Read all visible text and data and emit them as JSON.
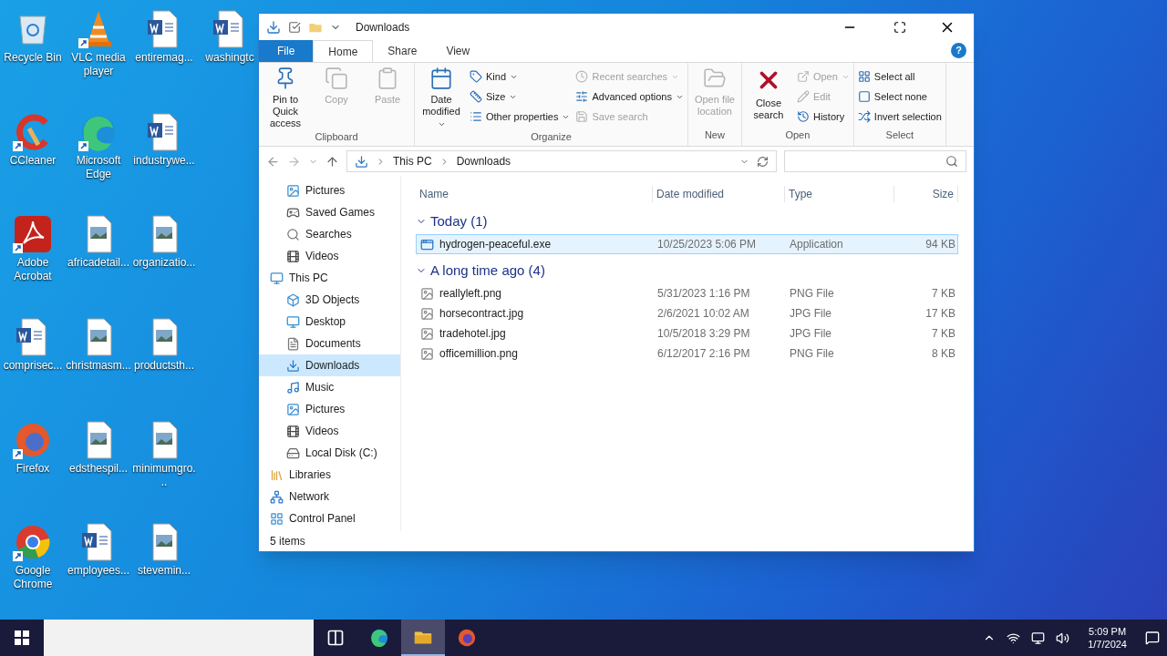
{
  "desktop_icons": [
    {
      "label": "Recycle Bin",
      "kind": "recycle",
      "shortcut": false
    },
    {
      "label": "CCleaner",
      "kind": "ccleaner",
      "shortcut": true
    },
    {
      "label": "Adobe Acrobat",
      "kind": "acrobat",
      "shortcut": true
    },
    {
      "label": "comprisec...",
      "kind": "word",
      "shortcut": false
    },
    {
      "label": "Firefox",
      "kind": "firefox",
      "shortcut": true
    },
    {
      "label": "Google Chrome",
      "kind": "chrome",
      "shortcut": true
    },
    {
      "label": "VLC media player",
      "kind": "vlc",
      "shortcut": true
    },
    {
      "label": "Microsoft Edge",
      "kind": "edge",
      "shortcut": true
    },
    {
      "label": "africadetail...",
      "kind": "image",
      "shortcut": false
    },
    {
      "label": "christmasm...",
      "kind": "image",
      "shortcut": false
    },
    {
      "label": "edsthespil...",
      "kind": "image",
      "shortcut": false
    },
    {
      "label": "employees...",
      "kind": "word",
      "shortcut": false
    },
    {
      "label": "entiremag...",
      "kind": "word",
      "shortcut": false
    },
    {
      "label": "industrywe...",
      "kind": "word",
      "shortcut": false
    },
    {
      "label": "organizatio...",
      "kind": "image",
      "shortcut": false
    },
    {
      "label": "productsth...",
      "kind": "image",
      "shortcut": false
    },
    {
      "label": "minimumgro...",
      "kind": "image",
      "shortcut": false
    },
    {
      "label": "stevemin...",
      "kind": "image",
      "shortcut": false
    },
    {
      "label": "washingtc",
      "kind": "word",
      "shortcut": false
    }
  ],
  "window": {
    "title": "Downloads",
    "help": "?",
    "tabs": [
      {
        "label": "File",
        "selected": false,
        "kind": "file"
      },
      {
        "label": "Home",
        "selected": true,
        "kind": "tab"
      },
      {
        "label": "Share",
        "selected": false,
        "kind": "tab"
      },
      {
        "label": "View",
        "selected": false,
        "kind": "tab"
      }
    ],
    "ribbon_groups": [
      {
        "label": "Clipboard",
        "items": [
          {
            "kind": "pin",
            "large": true,
            "label": "Pin to Quick access",
            "disabled": false,
            "dropdown": false
          },
          {
            "kind": "copy",
            "large": true,
            "label": "Copy",
            "disabled": true,
            "dropdown": false
          },
          {
            "kind": "paste",
            "large": true,
            "label": "Paste",
            "disabled": true,
            "dropdown": false
          }
        ]
      },
      {
        "label": "Organize",
        "items": [
          {
            "kind": "calendar",
            "large": true,
            "label": "Date modified",
            "disabled": false,
            "dropdown": true
          },
          {
            "kind": "tag",
            "large": false,
            "label": "Kind",
            "disabled": false,
            "dropdown": true
          },
          {
            "kind": "ruler",
            "large": false,
            "label": "Size",
            "disabled": false,
            "dropdown": true
          },
          {
            "kind": "list",
            "large": false,
            "label": "Other properties",
            "disabled": false,
            "dropdown": true
          },
          {
            "kind": "clock",
            "large": false,
            "label": "Recent searches",
            "disabled": true,
            "dropdown": true
          },
          {
            "kind": "sliders",
            "large": false,
            "label": "Advanced options",
            "disabled": false,
            "dropdown": true
          },
          {
            "kind": "save",
            "large": false,
            "label": "Save search",
            "disabled": true,
            "dropdown": false
          }
        ]
      },
      {
        "label": "New",
        "items": [
          {
            "kind": "folder",
            "large": true,
            "label": "Open file location",
            "disabled": true,
            "dropdown": false
          }
        ]
      },
      {
        "label": "Open",
        "items": [
          {
            "kind": "close",
            "large": true,
            "label": "Close search",
            "disabled": false,
            "dropdown": false
          },
          {
            "kind": "open",
            "large": false,
            "label": "Open",
            "disabled": true,
            "dropdown": true
          },
          {
            "kind": "pencil",
            "large": false,
            "label": "Edit",
            "disabled": true,
            "dropdown": false
          },
          {
            "kind": "history",
            "large": false,
            "label": "History",
            "disabled": false,
            "dropdown": false
          }
        ]
      },
      {
        "label": "Select",
        "items": [
          {
            "kind": "grid",
            "large": false,
            "label": "Select all",
            "disabled": false,
            "dropdown": false
          },
          {
            "kind": "square",
            "large": false,
            "label": "Select none",
            "disabled": false,
            "dropdown": false
          },
          {
            "kind": "shuffle",
            "large": false,
            "label": "Invert selection",
            "disabled": false,
            "dropdown": false
          }
        ]
      }
    ],
    "breadcrumb": [
      "This PC",
      "Downloads"
    ],
    "nav": {
      "upper_children": [
        {
          "label": "Pictures",
          "kind": "pictures",
          "selected": false
        },
        {
          "label": "Saved Games",
          "kind": "games",
          "selected": false
        },
        {
          "label": "Searches",
          "kind": "search",
          "selected": false
        },
        {
          "label": "Videos",
          "kind": "videos",
          "selected": false
        }
      ],
      "items": [
        {
          "label": "This PC",
          "kind": "pc",
          "selected": false,
          "children": [
            {
              "label": "3D Objects",
              "kind": "objects",
              "selected": false
            },
            {
              "label": "Desktop",
              "kind": "desktop",
              "selected": false
            },
            {
              "label": "Documents",
              "kind": "documents",
              "selected": false
            },
            {
              "label": "Downloads",
              "kind": "downloads",
              "selected": true
            },
            {
              "label": "Music",
              "kind": "music",
              "selected": false
            },
            {
              "label": "Pictures",
              "kind": "pictures",
              "selected": false
            },
            {
              "label": "Videos",
              "kind": "videos",
              "selected": false
            },
            {
              "label": "Local Disk (C:)",
              "kind": "disk",
              "selected": false
            }
          ]
        },
        {
          "label": "Libraries",
          "kind": "libraries",
          "selected": false
        },
        {
          "label": "Network",
          "kind": "network",
          "selected": false
        },
        {
          "label": "Control Panel",
          "kind": "control",
          "selected": false
        }
      ]
    },
    "columns": [
      "Name",
      "Date modified",
      "Type",
      "Size"
    ],
    "groups": [
      {
        "label": "Today (1)",
        "expanded": true,
        "files": [
          {
            "name": "hydrogen-peaceful.exe",
            "date": "10/25/2023 5:06 PM",
            "type": "Application",
            "size": "94 KB",
            "kind": "app",
            "selected": true
          }
        ]
      },
      {
        "label": "A long time ago (4)",
        "expanded": true,
        "files": [
          {
            "name": "reallyleft.png",
            "date": "5/31/2023 1:16 PM",
            "type": "PNG File",
            "size": "7 KB",
            "kind": "image",
            "selected": false
          },
          {
            "name": "horsecontract.jpg",
            "date": "2/6/2021 10:02 AM",
            "type": "JPG File",
            "size": "17 KB",
            "kind": "image",
            "selected": false
          },
          {
            "name": "tradehotel.jpg",
            "date": "10/5/2018 3:29 PM",
            "type": "JPG File",
            "size": "7 KB",
            "kind": "image",
            "selected": false
          },
          {
            "name": "officemillion.png",
            "date": "6/12/2017 2:16 PM",
            "type": "PNG File",
            "size": "8 KB",
            "kind": "image",
            "selected": false
          }
        ]
      }
    ],
    "status": "5 items"
  },
  "taskbar": {
    "apps": [
      {
        "kind": "taskview",
        "active": false
      },
      {
        "kind": "edge",
        "active": false
      },
      {
        "kind": "explorer",
        "active": true
      },
      {
        "kind": "firefox",
        "active": false
      }
    ],
    "time": "5:09 PM",
    "date": "1/7/2024"
  }
}
